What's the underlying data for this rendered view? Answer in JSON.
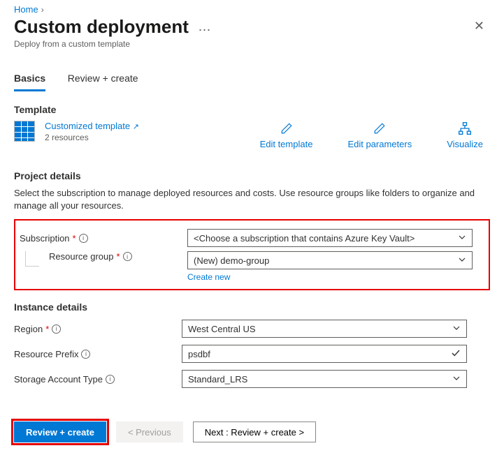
{
  "breadcrumb": {
    "home": "Home"
  },
  "header": {
    "title": "Custom deployment",
    "subtitle": "Deploy from a custom template"
  },
  "tabs": {
    "basics": "Basics",
    "review": "Review + create"
  },
  "template": {
    "section": "Template",
    "linkText": "Customized template",
    "resourceCount": "2 resources",
    "actions": {
      "editTemplate": "Edit template",
      "editParameters": "Edit parameters",
      "visualize": "Visualize"
    }
  },
  "project": {
    "section": "Project details",
    "description": "Select the subscription to manage deployed resources and costs. Use resource groups like folders to organize and manage all your resources.",
    "subscriptionLabel": "Subscription",
    "subscriptionValue": "<Choose a subscription that contains Azure Key Vault>",
    "resourceGroupLabel": "Resource group",
    "resourceGroupValue": "(New) demo-group",
    "createNew": "Create new"
  },
  "instance": {
    "section": "Instance details",
    "regionLabel": "Region",
    "regionValue": "West Central US",
    "prefixLabel": "Resource Prefix",
    "prefixValue": "psdbf",
    "storageLabel": "Storage Account Type",
    "storageValue": "Standard_LRS"
  },
  "footer": {
    "reviewCreate": "Review + create",
    "previous": "< Previous",
    "next": "Next : Review + create >"
  }
}
